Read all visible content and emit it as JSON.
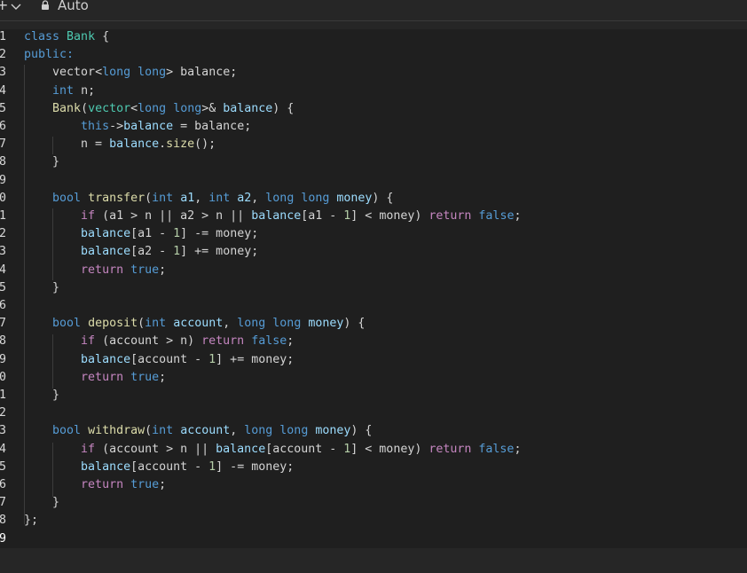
{
  "toolbar": {
    "plus_label": "+",
    "mode_label": "Auto",
    "icons": [
      "plus-icon",
      "chevron-down-icon",
      "lock-icon"
    ]
  },
  "editor": {
    "language": "cpp",
    "colors": {
      "background": "#1f1f1f",
      "keyword": "#569cd6",
      "control": "#c586c0",
      "type": "#4ec9b0",
      "function": "#dcdcaa",
      "variable": "#9cdcfe",
      "number": "#b5cea8",
      "text": "#d4d4d4"
    },
    "lines": [
      {
        "num": "1",
        "tokens": [
          [
            "kw",
            "class"
          ],
          [
            "op",
            " "
          ],
          [
            "ty",
            "Bank"
          ],
          [
            "op",
            " {"
          ]
        ]
      },
      {
        "num": "2",
        "tokens": [
          [
            "kw",
            "public:"
          ]
        ]
      },
      {
        "num": "3",
        "tokens": [
          [
            "op",
            "    vector"
          ],
          [
            "op",
            "<"
          ],
          [
            "kw",
            "long"
          ],
          [
            "op",
            " "
          ],
          [
            "kw",
            "long"
          ],
          [
            "op",
            "> balance;"
          ]
        ]
      },
      {
        "num": "4",
        "tokens": [
          [
            "op",
            "    "
          ],
          [
            "kw",
            "int"
          ],
          [
            "op",
            " n;"
          ]
        ]
      },
      {
        "num": "5",
        "tokens": [
          [
            "op",
            "    "
          ],
          [
            "fn",
            "Bank"
          ],
          [
            "op",
            "("
          ],
          [
            "ty",
            "vector"
          ],
          [
            "op",
            "<"
          ],
          [
            "kw",
            "long"
          ],
          [
            "op",
            " "
          ],
          [
            "kw",
            "long"
          ],
          [
            "op",
            ">& "
          ],
          [
            "var",
            "balance"
          ],
          [
            "op",
            ") {"
          ]
        ]
      },
      {
        "num": "6",
        "tokens": [
          [
            "op",
            "        "
          ],
          [
            "kw",
            "this"
          ],
          [
            "op",
            "->"
          ],
          [
            "var",
            "balance"
          ],
          [
            "op",
            " = balance;"
          ]
        ]
      },
      {
        "num": "7",
        "tokens": [
          [
            "op",
            "        n = "
          ],
          [
            "var",
            "balance"
          ],
          [
            "op",
            "."
          ],
          [
            "fn",
            "size"
          ],
          [
            "op",
            "();"
          ]
        ]
      },
      {
        "num": "8",
        "tokens": [
          [
            "op",
            "    }"
          ]
        ]
      },
      {
        "num": "9",
        "tokens": []
      },
      {
        "num": "0",
        "tokens": [
          [
            "op",
            "    "
          ],
          [
            "kw",
            "bool"
          ],
          [
            "op",
            " "
          ],
          [
            "fn",
            "transfer"
          ],
          [
            "op",
            "("
          ],
          [
            "kw",
            "int"
          ],
          [
            "op",
            " "
          ],
          [
            "var",
            "a1"
          ],
          [
            "op",
            ", "
          ],
          [
            "kw",
            "int"
          ],
          [
            "op",
            " "
          ],
          [
            "var",
            "a2"
          ],
          [
            "op",
            ", "
          ],
          [
            "kw",
            "long"
          ],
          [
            "op",
            " "
          ],
          [
            "kw",
            "long"
          ],
          [
            "op",
            " "
          ],
          [
            "var",
            "money"
          ],
          [
            "op",
            ") {"
          ]
        ]
      },
      {
        "num": "1",
        "tokens": [
          [
            "op",
            "        "
          ],
          [
            "ctl",
            "if"
          ],
          [
            "op",
            " (a1 > n || a2 > n || "
          ],
          [
            "var",
            "balance"
          ],
          [
            "op",
            "[a1 - "
          ],
          [
            "num",
            "1"
          ],
          [
            "op",
            "] < money) "
          ],
          [
            "ctl",
            "return"
          ],
          [
            "op",
            " "
          ],
          [
            "kw",
            "false"
          ],
          [
            "op",
            ";"
          ]
        ]
      },
      {
        "num": "2",
        "tokens": [
          [
            "op",
            "        "
          ],
          [
            "var",
            "balance"
          ],
          [
            "op",
            "[a1 - "
          ],
          [
            "num",
            "1"
          ],
          [
            "op",
            "] -= money;"
          ]
        ]
      },
      {
        "num": "3",
        "tokens": [
          [
            "op",
            "        "
          ],
          [
            "var",
            "balance"
          ],
          [
            "op",
            "[a2 - "
          ],
          [
            "num",
            "1"
          ],
          [
            "op",
            "] += money;"
          ]
        ]
      },
      {
        "num": "4",
        "tokens": [
          [
            "op",
            "        "
          ],
          [
            "ctl",
            "return"
          ],
          [
            "op",
            " "
          ],
          [
            "kw",
            "true"
          ],
          [
            "op",
            ";"
          ]
        ]
      },
      {
        "num": "5",
        "tokens": [
          [
            "op",
            "    }"
          ]
        ]
      },
      {
        "num": "6",
        "tokens": []
      },
      {
        "num": "7",
        "tokens": [
          [
            "op",
            "    "
          ],
          [
            "kw",
            "bool"
          ],
          [
            "op",
            " "
          ],
          [
            "fn",
            "deposit"
          ],
          [
            "op",
            "("
          ],
          [
            "kw",
            "int"
          ],
          [
            "op",
            " "
          ],
          [
            "var",
            "account"
          ],
          [
            "op",
            ", "
          ],
          [
            "kw",
            "long"
          ],
          [
            "op",
            " "
          ],
          [
            "kw",
            "long"
          ],
          [
            "op",
            " "
          ],
          [
            "var",
            "money"
          ],
          [
            "op",
            ") {"
          ]
        ]
      },
      {
        "num": "8",
        "tokens": [
          [
            "op",
            "        "
          ],
          [
            "ctl",
            "if"
          ],
          [
            "op",
            " (account > n) "
          ],
          [
            "ctl",
            "return"
          ],
          [
            "op",
            " "
          ],
          [
            "kw",
            "false"
          ],
          [
            "op",
            ";"
          ]
        ]
      },
      {
        "num": "9",
        "tokens": [
          [
            "op",
            "        "
          ],
          [
            "var",
            "balance"
          ],
          [
            "op",
            "[account - "
          ],
          [
            "num",
            "1"
          ],
          [
            "op",
            "] += money;"
          ]
        ]
      },
      {
        "num": "0",
        "tokens": [
          [
            "op",
            "        "
          ],
          [
            "ctl",
            "return"
          ],
          [
            "op",
            " "
          ],
          [
            "kw",
            "true"
          ],
          [
            "op",
            ";"
          ]
        ]
      },
      {
        "num": "1",
        "tokens": [
          [
            "op",
            "    }"
          ]
        ]
      },
      {
        "num": "2",
        "tokens": []
      },
      {
        "num": "3",
        "tokens": [
          [
            "op",
            "    "
          ],
          [
            "kw",
            "bool"
          ],
          [
            "op",
            " "
          ],
          [
            "fn",
            "withdraw"
          ],
          [
            "op",
            "("
          ],
          [
            "kw",
            "int"
          ],
          [
            "op",
            " "
          ],
          [
            "var",
            "account"
          ],
          [
            "op",
            ", "
          ],
          [
            "kw",
            "long"
          ],
          [
            "op",
            " "
          ],
          [
            "kw",
            "long"
          ],
          [
            "op",
            " "
          ],
          [
            "var",
            "money"
          ],
          [
            "op",
            ") {"
          ]
        ]
      },
      {
        "num": "4",
        "tokens": [
          [
            "op",
            "        "
          ],
          [
            "ctl",
            "if"
          ],
          [
            "op",
            " (account > n || "
          ],
          [
            "var",
            "balance"
          ],
          [
            "op",
            "[account - "
          ],
          [
            "num",
            "1"
          ],
          [
            "op",
            "] < money) "
          ],
          [
            "ctl",
            "return"
          ],
          [
            "op",
            " "
          ],
          [
            "kw",
            "false"
          ],
          [
            "op",
            ";"
          ]
        ]
      },
      {
        "num": "5",
        "tokens": [
          [
            "op",
            "        "
          ],
          [
            "var",
            "balance"
          ],
          [
            "op",
            "[account - "
          ],
          [
            "num",
            "1"
          ],
          [
            "op",
            "] -= money;"
          ]
        ]
      },
      {
        "num": "6",
        "tokens": [
          [
            "op",
            "        "
          ],
          [
            "ctl",
            "return"
          ],
          [
            "op",
            " "
          ],
          [
            "kw",
            "true"
          ],
          [
            "op",
            ";"
          ]
        ]
      },
      {
        "num": "7",
        "tokens": [
          [
            "op",
            "    }"
          ]
        ]
      },
      {
        "num": "8",
        "tokens": [
          [
            "op",
            "};"
          ]
        ]
      },
      {
        "num": "9",
        "tokens": []
      }
    ]
  }
}
